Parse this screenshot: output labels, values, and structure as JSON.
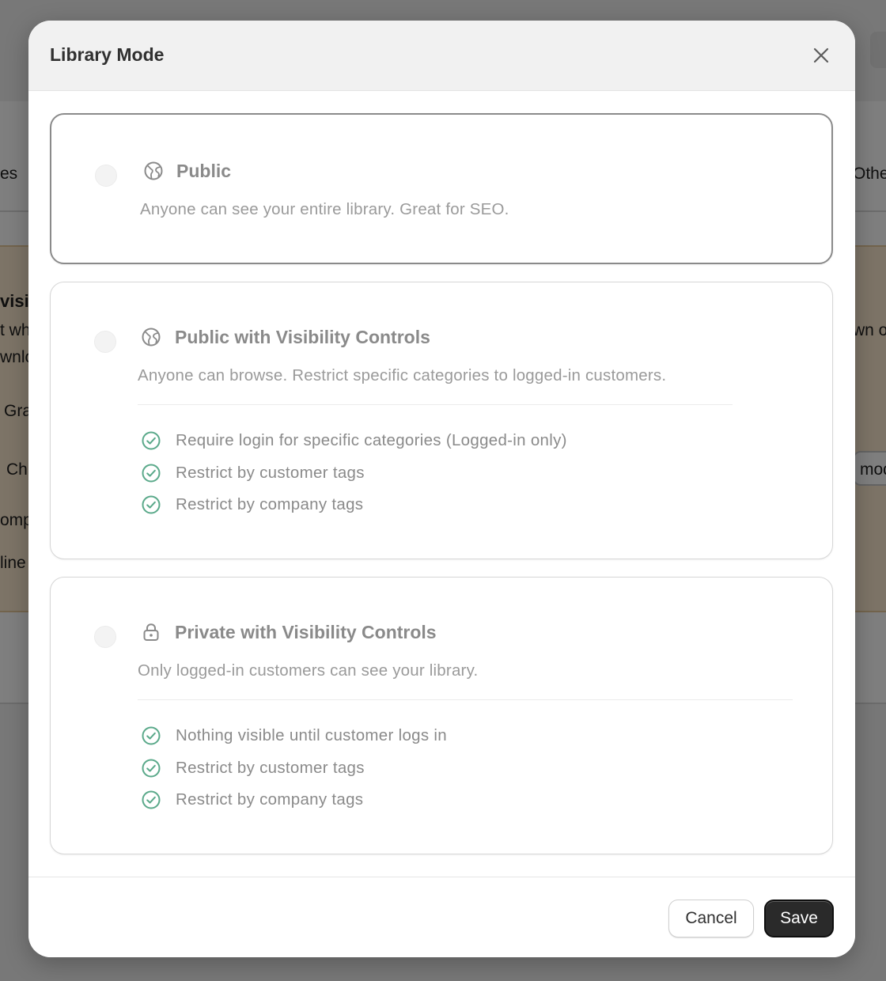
{
  "background": {
    "fragments": [
      "es",
      "Othe",
      "visi",
      "t wh",
      "wnlo",
      "wn or",
      "Gra",
      "Ch",
      "mod",
      "omp",
      "line"
    ]
  },
  "modal": {
    "title": "Library Mode",
    "close_icon": "close-icon",
    "options": [
      {
        "id": "public",
        "icon": "globe-icon",
        "title": "Public",
        "description": "Anyone can see your entire library. Great for SEO.",
        "features": []
      },
      {
        "id": "public-visibility",
        "icon": "globe-icon",
        "title": "Public with Visibility Controls",
        "description": "Anyone can browse. Restrict specific categories to logged-in customers.",
        "features": [
          "Require login for specific categories (Logged-in only)",
          "Restrict by customer tags",
          "Restrict by company tags"
        ]
      },
      {
        "id": "private-visibility",
        "icon": "lock-icon",
        "title": "Private with Visibility Controls",
        "description": "Only logged-in customers can see your library.",
        "features": [
          "Nothing visible until customer logs in",
          "Restrict by customer tags",
          "Restrict by company tags"
        ]
      }
    ],
    "feature_icon": "check-circle-icon",
    "footer": {
      "cancel_label": "Cancel",
      "save_label": "Save"
    }
  },
  "colors": {
    "check_green": "#5aa98a",
    "save_bg": "#2a2a2a",
    "header_bg": "#f1f1f1"
  }
}
